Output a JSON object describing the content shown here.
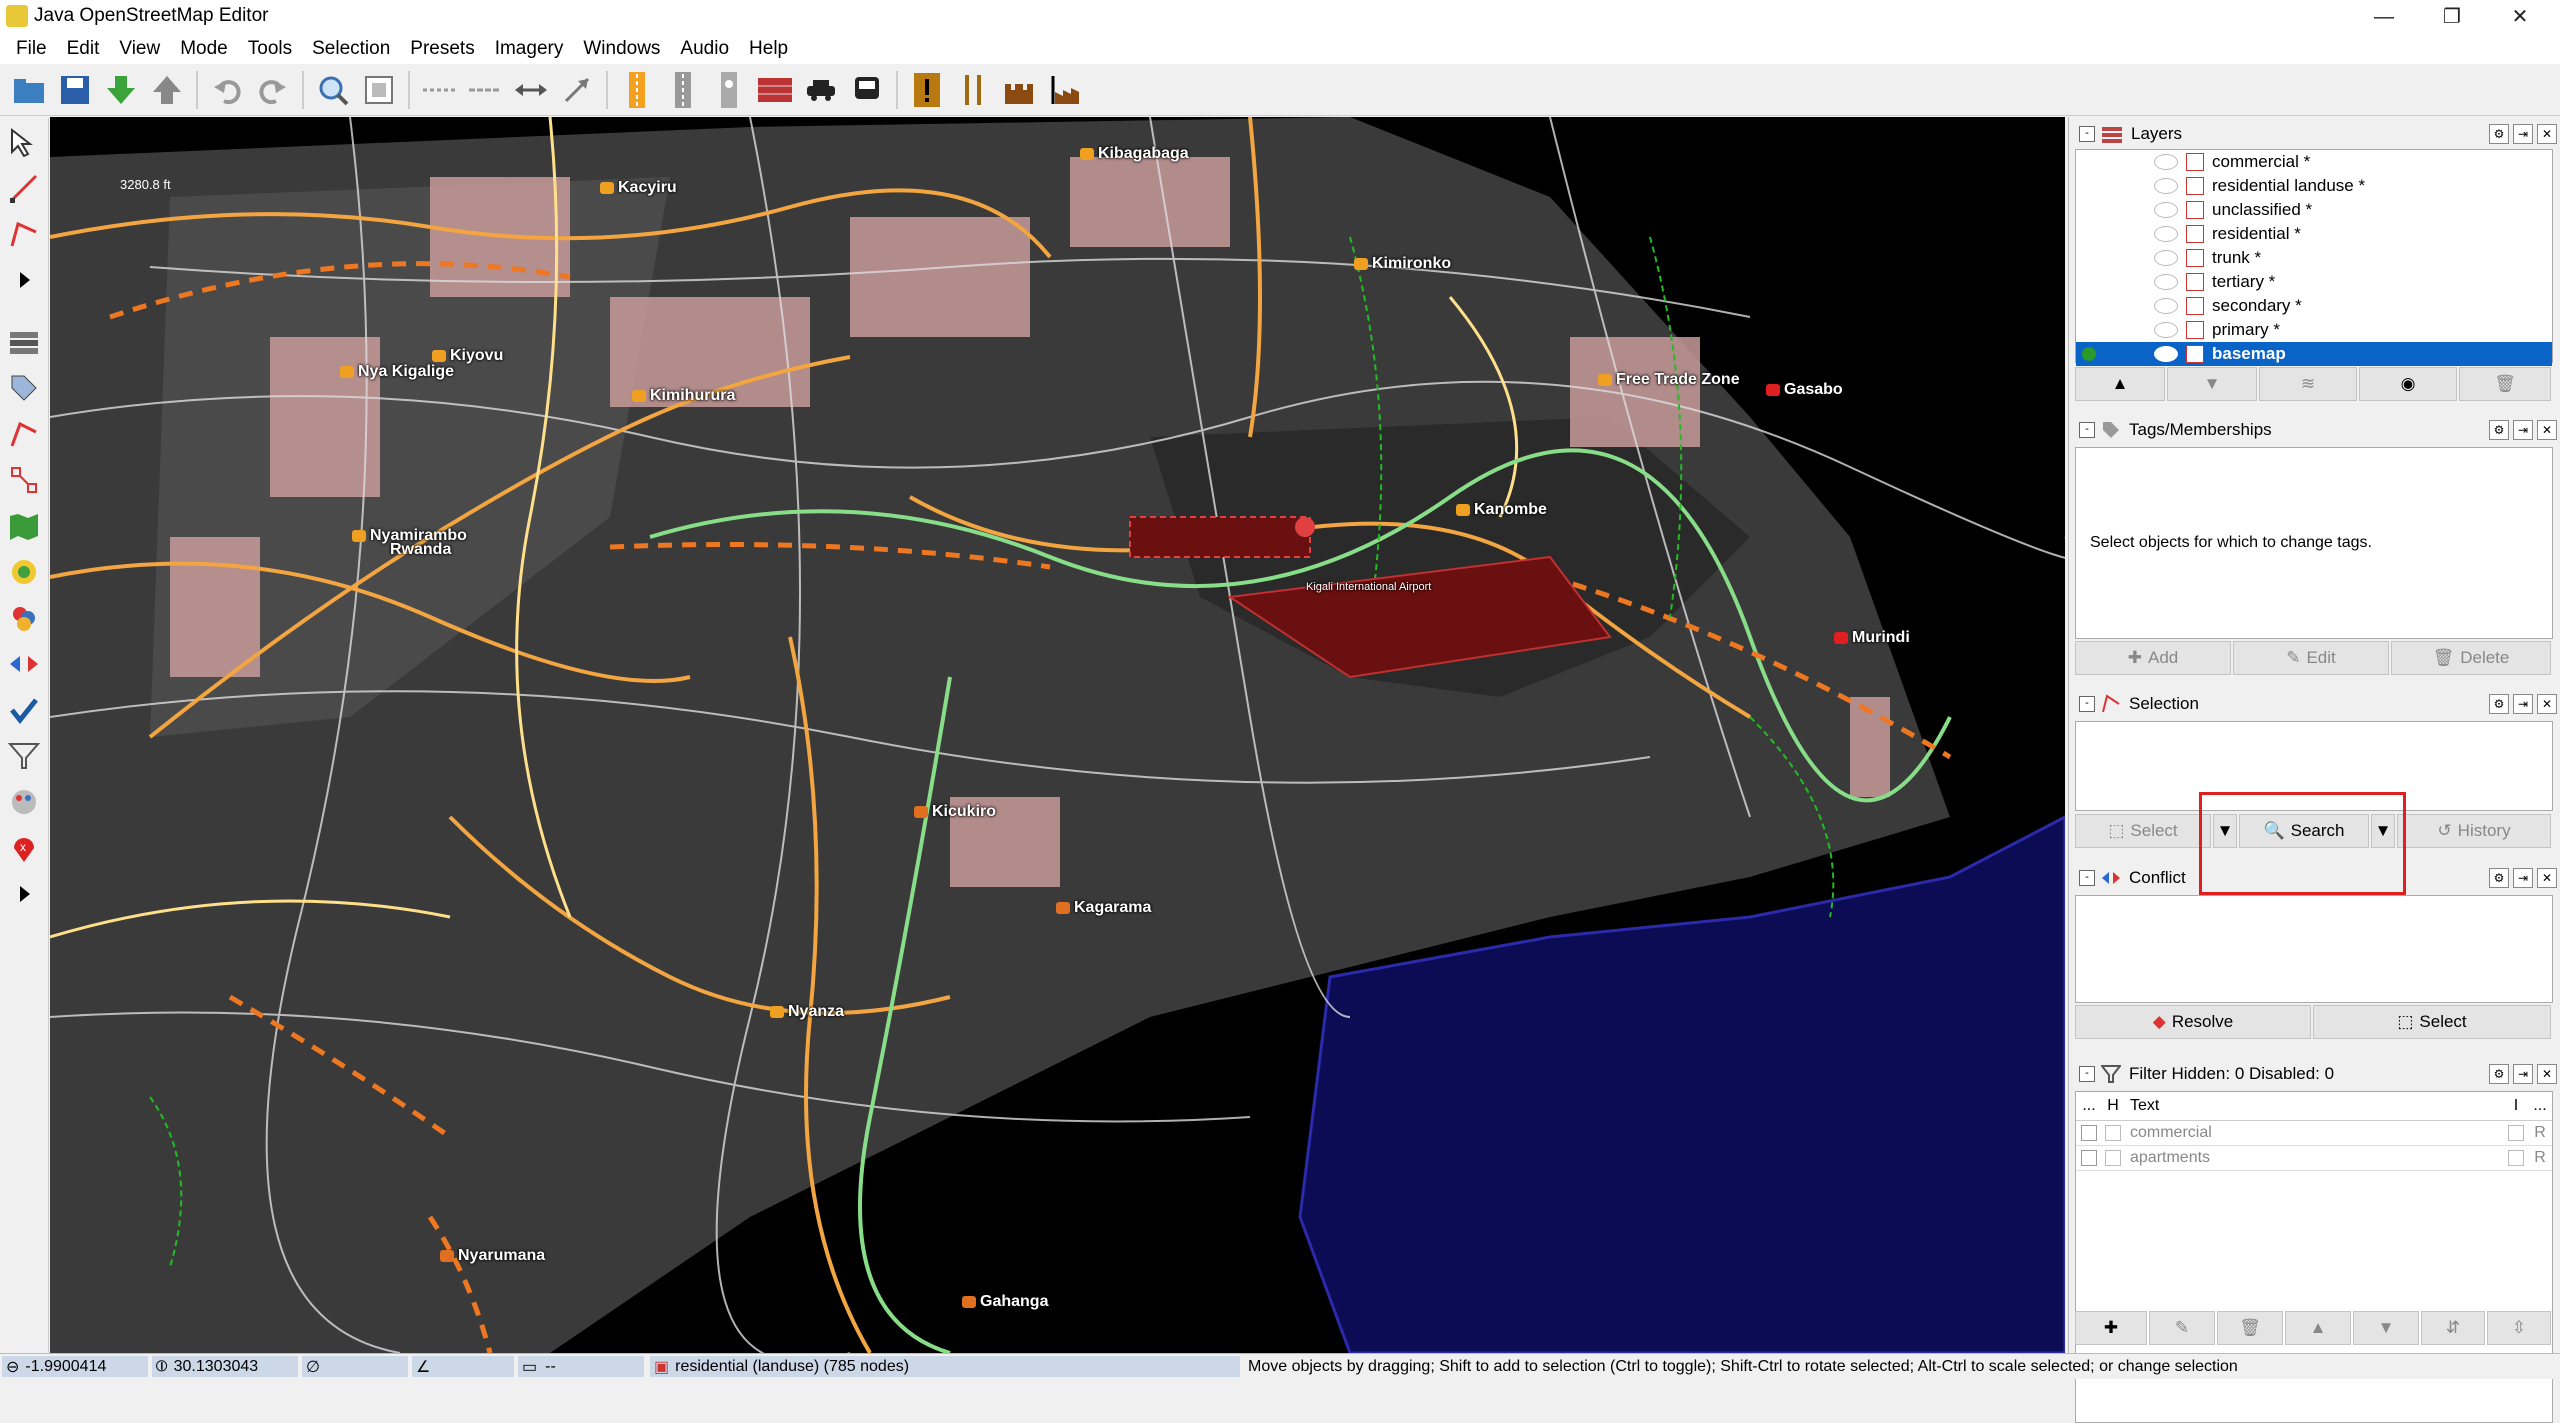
{
  "window": {
    "title": "Java OpenStreetMap Editor",
    "minimize": "—",
    "maximize": "❐",
    "close": "✕"
  },
  "menu": [
    "File",
    "Edit",
    "View",
    "Mode",
    "Tools",
    "Selection",
    "Presets",
    "Imagery",
    "Windows",
    "Audio",
    "Help"
  ],
  "map": {
    "scale": "3280.8 ft",
    "places": [
      {
        "name": "Kibagabaga"
      },
      {
        "name": "Kacyiru"
      },
      {
        "name": "Kimironko"
      },
      {
        "name": "Kiyovu"
      },
      {
        "name": "Nya Kigalige"
      },
      {
        "name": "Kimihurura"
      },
      {
        "name": "Free Trade Zone"
      },
      {
        "name": "Gasabo"
      },
      {
        "name": "Kanombe"
      },
      {
        "name": "Nyamirambo"
      },
      {
        "name": "Rwanda"
      },
      {
        "name": "Kigali International Airport"
      },
      {
        "name": "Murindi"
      },
      {
        "name": "Kicukiro"
      },
      {
        "name": "Kagarama"
      },
      {
        "name": "Nyanza"
      },
      {
        "name": "Nyarumana"
      },
      {
        "name": "Gahanga"
      }
    ]
  },
  "layers": {
    "title": "Layers",
    "items": [
      {
        "name": "commercial *",
        "active": false
      },
      {
        "name": "residential landuse *",
        "active": false
      },
      {
        "name": "unclassified *",
        "active": false
      },
      {
        "name": "residential *",
        "active": false
      },
      {
        "name": "trunk *",
        "active": false
      },
      {
        "name": "tertiary *",
        "active": false
      },
      {
        "name": "secondary *",
        "active": false
      },
      {
        "name": "primary *",
        "active": false
      },
      {
        "name": "basemap",
        "active": true
      }
    ]
  },
  "tags": {
    "title": "Tags/Memberships",
    "empty_text": "Select objects for which to change tags.",
    "add": "Add",
    "edit": "Edit",
    "delete": "Delete"
  },
  "selection": {
    "title": "Selection",
    "select": "Select",
    "search": "Search",
    "history": "History"
  },
  "conflict": {
    "title": "Conflict",
    "resolve": "Resolve",
    "select": "Select"
  },
  "filter": {
    "title": "Filter Hidden: 0 Disabled: 0",
    "col_dots": "...",
    "col_h": "H",
    "col_text": "Text",
    "col_i": "I",
    "col_dots2": "...",
    "rows": [
      {
        "text": "commercial",
        "flag": "R"
      },
      {
        "text": "apartments",
        "flag": "R"
      }
    ]
  },
  "status": {
    "lat": "-1.9900414",
    "lon": "30.1303043",
    "dist": "--",
    "info": "residential (landuse) (785 nodes)",
    "help": "Move objects by dragging; Shift to add to selection (Ctrl to toggle); Shift-Ctrl to rotate selected; Alt-Ctrl to scale selected; or change selection"
  }
}
